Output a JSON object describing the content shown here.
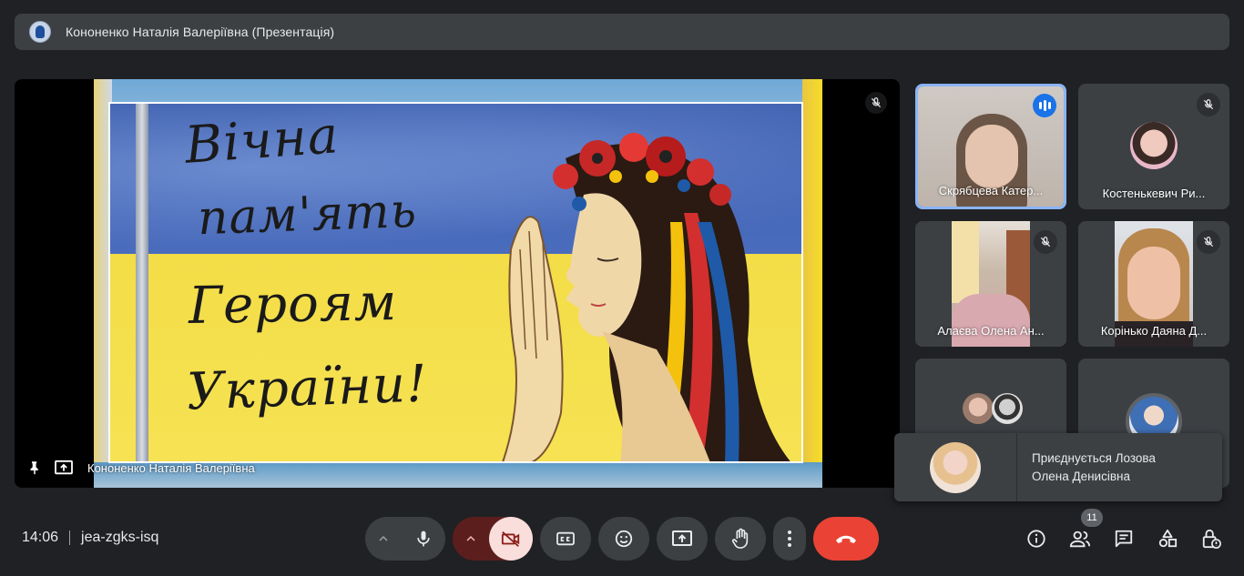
{
  "header": {
    "presenter_title": "Кононенко Наталія Валеріївна (Презентація)"
  },
  "stage": {
    "slide_lines": [
      "Вічна",
      "пам'ять",
      "Героям",
      "України!"
    ],
    "presenter_name": "Кононенко Наталія Валеріївна"
  },
  "participants": [
    {
      "name": "Скрябцева Катер...",
      "speaking": true
    },
    {
      "name": "Костенькевич Ри...",
      "muted": true
    },
    {
      "name": "Алаєва Олена Ан...",
      "muted": true
    },
    {
      "name": "Корінько Даяна Д...",
      "muted": true
    }
  ],
  "notification": {
    "line1": "Приєднується Лозова",
    "line2": "Олена Денисівна"
  },
  "footer": {
    "time": "14:06",
    "meeting_code": "jea-zgks-isq",
    "participant_count": "11"
  },
  "colors": {
    "background": "#202124",
    "panel": "#3c4043",
    "accent": "#8ab4f8",
    "end_call": "#ea4335",
    "camera_off": "#f9dedc"
  },
  "icons": [
    "mic-off-icon",
    "pin-icon",
    "present-icon",
    "mic-icon",
    "camera-off-icon",
    "captions-icon",
    "emoji-icon",
    "present-now-icon",
    "raise-hand-icon",
    "more-icon",
    "end-call-icon",
    "info-icon",
    "people-icon",
    "chat-icon",
    "activities-icon",
    "host-controls-icon"
  ]
}
